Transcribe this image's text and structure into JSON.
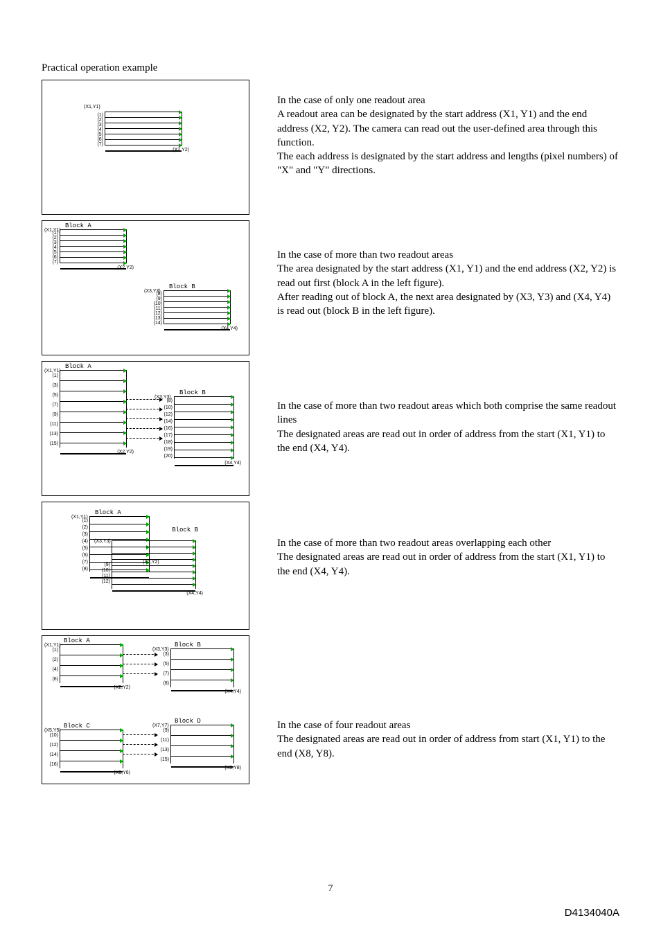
{
  "heading": "Practical operation example",
  "page_number": "7",
  "doc_code": "D4134040A",
  "sections": [
    {
      "desc": "In the case of only one readout area\nA readout area can be designated by the start address (X1, Y1) and the end address (X2, Y2). The camera can read out the user-defined area through this function.\nThe each address is designated by the start address and lengths (pixel numbers) of \"X\" and \"Y\" directions."
    },
    {
      "desc": "In the case of more than two readout areas\nThe area designated by the start address (X1, Y1) and the end address (X2, Y2) is read out first (block A in the left figure).\nAfter reading out of block A, the next area designated by (X3, Y3) and (X4, Y4) is read out (block B in the left figure)."
    },
    {
      "desc": "In the case of more than two readout areas which both comprise the same readout lines\nThe designated areas are read out in order of address from the start (X1, Y1) to the end (X4, Y4)."
    },
    {
      "desc": "In the case of more than two readout areas overlapping each other\nThe designated areas are read out in order of address from the start (X1, Y1) to the end (X4, Y4)."
    },
    {
      "desc": "In the case of four readout areas\nThe designated areas are read out in order of address from start (X1, Y1) to the end (X8, Y8)."
    }
  ],
  "labels": {
    "blockA": "Block A",
    "blockB": "Block B",
    "blockC": "Block C",
    "blockD": "Block D",
    "x1y1": "(X1,Y1)",
    "x2y2": "(X2,Y2)",
    "x3y3": "(X3,Y3)",
    "x4y4": "(X4,Y4)",
    "x5y5": "(X5,Y5)",
    "x6y6": "(X6,Y6)",
    "x7y7": "(X7,Y7)",
    "x8y8": "(X8,Y8)"
  },
  "rowsets": {
    "r1_7": [
      "(1)",
      "(2)",
      "(3)",
      "(4)",
      "(5)",
      "(6)",
      "(7)"
    ],
    "r8_14": [
      "(8)",
      "(9)",
      "(10)",
      "(11)",
      "(12)",
      "(13)",
      "(14)"
    ],
    "r_odd_15": [
      "(1)",
      "(3)",
      "(5)",
      "(7)",
      "(9)",
      "(11)",
      "(13)",
      "(15)"
    ],
    "r_a_over": [
      "(1)",
      "(2)",
      "(3)",
      "(4)",
      "(5)",
      "(6)",
      "(7)",
      "(8)"
    ],
    "r_b_over": [
      "(9)",
      "(10)",
      "(11)",
      "(12)"
    ],
    "r_a4": [
      "(1)",
      "(2)",
      "(4)",
      "(6)"
    ],
    "r_b4": [
      "(3)",
      "(5)",
      "(7)",
      "(8)"
    ],
    "r_c4": [
      "(10)",
      "(12)",
      "(14)",
      "(16)"
    ],
    "r_d4": [
      "(9)",
      "(11)",
      "(13)",
      "(15)"
    ],
    "r_third_b": [
      "(8)",
      "(10)",
      "(12)",
      "(14)",
      "(16)",
      "(17)",
      "(18)",
      "(19)",
      "(20)"
    ]
  }
}
